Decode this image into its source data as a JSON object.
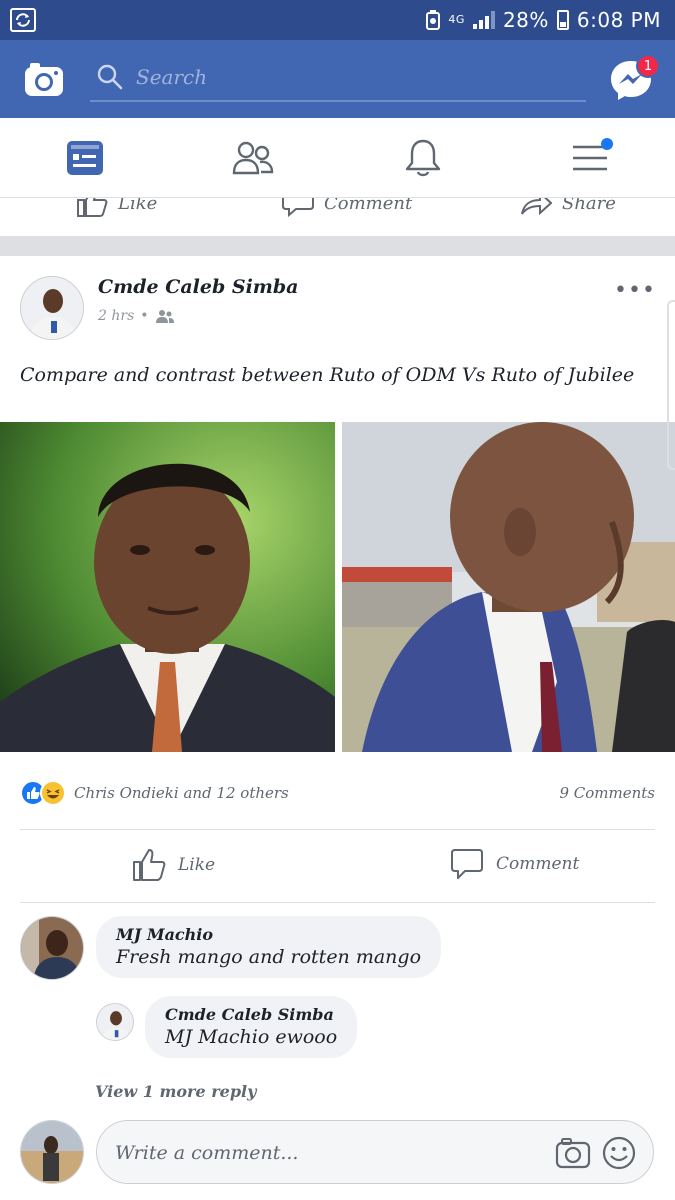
{
  "status_bar": {
    "network": "4G",
    "battery": "28%",
    "time": "6:08 PM"
  },
  "app_bar": {
    "search_placeholder": "Search",
    "messenger_badge": "1"
  },
  "prev_post_actions": {
    "like": "Like",
    "comment": "Comment",
    "share": "Share"
  },
  "post": {
    "author": "Cmde Caleb Simba",
    "time": "2 hrs",
    "text": "Compare and contrast between Ruto of ODM Vs Ruto of Jubilee",
    "reactions_text": "Chris Ondieki and 12 others",
    "comments_count": "9 Comments",
    "actions": {
      "like": "Like",
      "comment": "Comment"
    }
  },
  "comments": [
    {
      "author": "MJ Machio",
      "text": "Fresh mango and rotten mango"
    },
    {
      "author": "Cmde Caleb Simba",
      "text": "MJ Machio ewooo"
    }
  ],
  "view_more_replies": "View 1 more reply",
  "write_comment": {
    "placeholder": "Write a comment..."
  },
  "colors": {
    "status_bar": "#2e4b8e",
    "app_bar": "#4267b2",
    "accent": "#1877f2",
    "badge": "#f02849"
  }
}
